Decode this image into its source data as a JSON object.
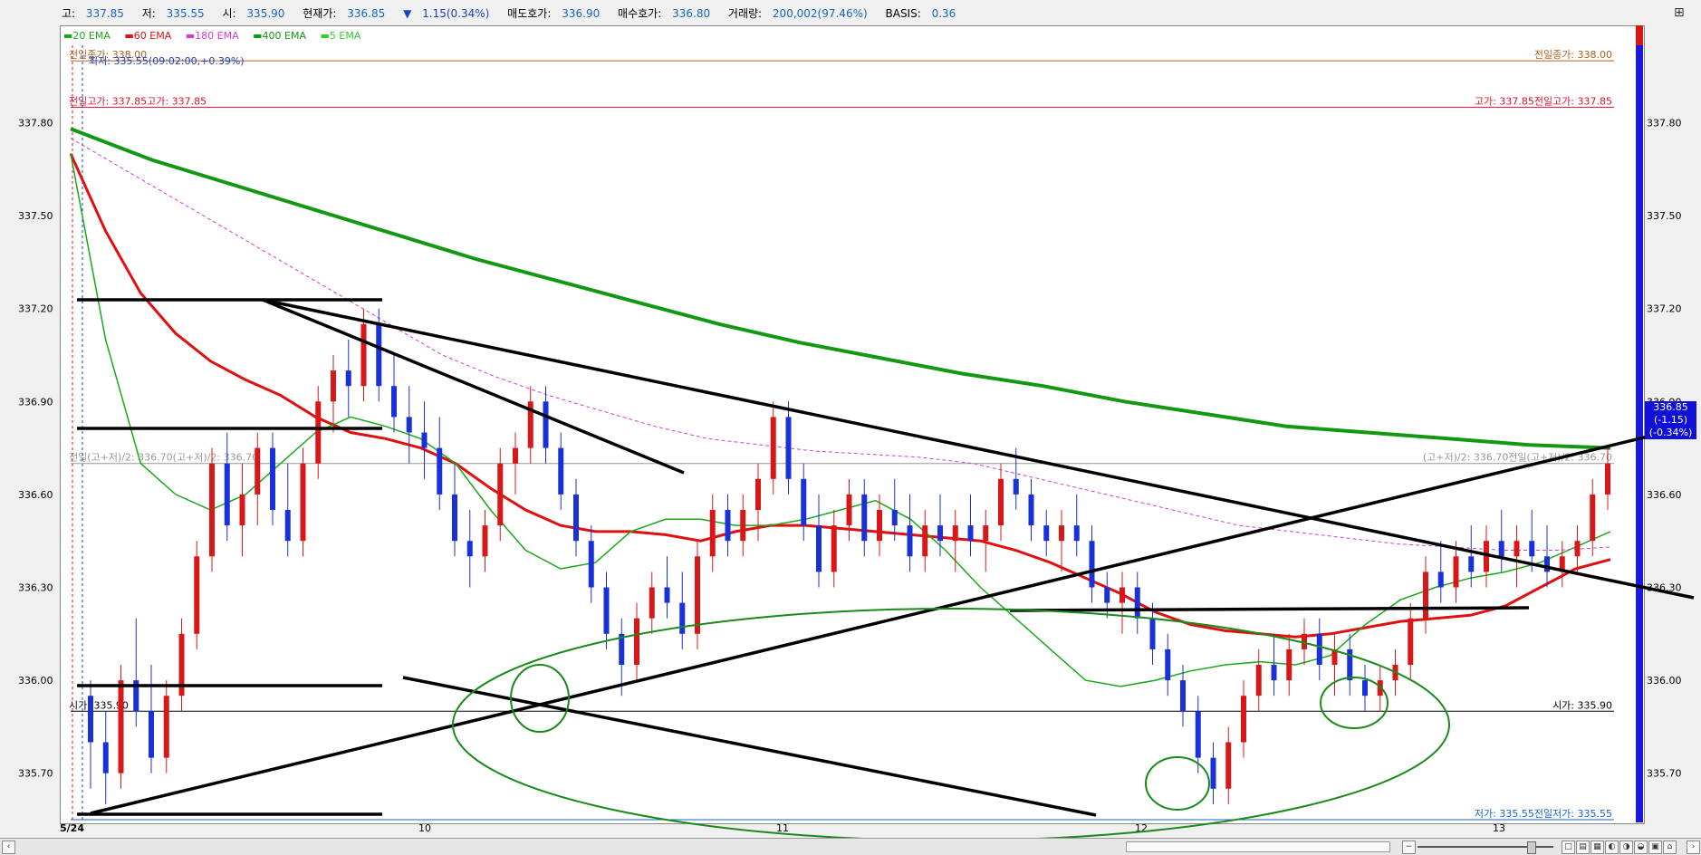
{
  "header": {
    "high_label": "고:",
    "high": "337.85",
    "low_label": "저:",
    "low": "335.55",
    "open_label": "시:",
    "open": "335.90",
    "current_label": "현재가:",
    "current": "336.85",
    "change_arrow": "▼",
    "change": "1.15(0.34%)",
    "ask_label": "매도호가:",
    "ask": "336.90",
    "bid_label": "매수호가:",
    "bid": "336.80",
    "volume_label": "거래량:",
    "volume": "200,002(97.46%)",
    "basis_label": "BASIS:",
    "basis": "0.36",
    "menu_icon": "grid-menu-icon"
  },
  "legend": [
    {
      "label": "20 EMA",
      "color": "#1aa81a"
    },
    {
      "label": "60 EMA",
      "color": "#e01010"
    },
    {
      "label": "180 EMA",
      "color": "#d040d0"
    },
    {
      "label": "400 EMA",
      "color": "#139813"
    },
    {
      "label": "5 EMA",
      "color": "#33cc33"
    }
  ],
  "price_tag": {
    "price": "336.85",
    "change": "(-1.15)",
    "pct": "(-0.34%)"
  },
  "chart_data": {
    "type": "candlestick",
    "title": "",
    "x_labels": [
      "5/24",
      "10",
      "11",
      "12",
      "13"
    ],
    "y_ticks": [
      "337.80",
      "337.50",
      "337.20",
      "336.90",
      "336.60",
      "336.30",
      "336.00",
      "335.70"
    ],
    "ylim": [
      335.55,
      338.05
    ],
    "reference_lines": [
      {
        "label_left": "전일종가: 338.00",
        "label_right": "전일종가: 338.00",
        "value": 338.0,
        "color": "#b06020"
      },
      {
        "label_left": "전일고가: 337.85",
        "label_left2": "고가: 337.85",
        "label_right": "고가: 337.85",
        "label_right2": "전일고가: 337.85",
        "value": 337.85,
        "color": "#e01030"
      },
      {
        "label_left": "전일(고+저)/2: 336.70",
        "label_left2": "(고+저)/2: 336.70",
        "label_right": "(고+저)/2: 336.70",
        "label_right2": "전일(고+저)/2: 336.70",
        "value": 336.7,
        "color": "#999999"
      },
      {
        "label_left": "시가: 335.90",
        "label_right": "시가: 335.90",
        "value": 335.9,
        "color": "#000000"
      },
      {
        "label_right": "저가: 335.55",
        "label_right2": "전일저가: 335.55",
        "value": 335.55,
        "color": "#1a66c4"
      }
    ],
    "annotation": "최저: 335.55(09:02:00,+0.39%)",
    "candles": [
      [
        335.95,
        336.0,
        335.65,
        335.8
      ],
      [
        335.8,
        335.9,
        335.6,
        335.7
      ],
      [
        335.7,
        336.05,
        335.65,
        336.0
      ],
      [
        336.0,
        336.2,
        335.85,
        335.9
      ],
      [
        335.9,
        336.05,
        335.7,
        335.75
      ],
      [
        335.75,
        336.0,
        335.7,
        335.95
      ],
      [
        335.95,
        336.2,
        335.9,
        336.15
      ],
      [
        336.15,
        336.45,
        336.1,
        336.4
      ],
      [
        336.4,
        336.75,
        336.35,
        336.7
      ],
      [
        336.7,
        336.8,
        336.45,
        336.5
      ],
      [
        336.5,
        336.7,
        336.4,
        336.6
      ],
      [
        336.6,
        336.8,
        336.5,
        336.75
      ],
      [
        336.75,
        336.8,
        336.5,
        336.55
      ],
      [
        336.55,
        336.7,
        336.4,
        336.45
      ],
      [
        336.45,
        336.75,
        336.4,
        336.7
      ],
      [
        336.7,
        336.95,
        336.65,
        336.9
      ],
      [
        336.9,
        337.05,
        336.8,
        337.0
      ],
      [
        337.0,
        337.1,
        336.85,
        336.95
      ],
      [
        336.95,
        337.2,
        336.9,
        337.15
      ],
      [
        337.15,
        337.2,
        336.9,
        336.95
      ],
      [
        336.95,
        337.05,
        336.8,
        336.85
      ],
      [
        336.85,
        336.95,
        336.7,
        336.8
      ],
      [
        336.8,
        336.9,
        336.65,
        336.75
      ],
      [
        336.75,
        336.85,
        336.55,
        336.6
      ],
      [
        336.6,
        336.7,
        336.4,
        336.45
      ],
      [
        336.45,
        336.55,
        336.3,
        336.4
      ],
      [
        336.4,
        336.55,
        336.35,
        336.5
      ],
      [
        336.5,
        336.75,
        336.45,
        336.7
      ],
      [
        336.7,
        336.8,
        336.6,
        336.75
      ],
      [
        336.75,
        336.95,
        336.7,
        336.9
      ],
      [
        336.9,
        336.95,
        336.7,
        336.75
      ],
      [
        336.75,
        336.8,
        336.55,
        336.6
      ],
      [
        336.6,
        336.65,
        336.4,
        336.45
      ],
      [
        336.45,
        336.5,
        336.25,
        336.3
      ],
      [
        336.3,
        336.35,
        336.1,
        336.15
      ],
      [
        336.15,
        336.2,
        335.95,
        336.05
      ],
      [
        336.05,
        336.25,
        336.0,
        336.2
      ],
      [
        336.2,
        336.35,
        336.15,
        336.3
      ],
      [
        336.3,
        336.4,
        336.2,
        336.25
      ],
      [
        336.25,
        336.35,
        336.1,
        336.15
      ],
      [
        336.15,
        336.45,
        336.1,
        336.4
      ],
      [
        336.4,
        336.6,
        336.35,
        336.55
      ],
      [
        336.55,
        336.6,
        336.4,
        336.45
      ],
      [
        336.45,
        336.6,
        336.4,
        336.55
      ],
      [
        336.55,
        336.7,
        336.45,
        336.65
      ],
      [
        336.65,
        336.9,
        336.6,
        336.85
      ],
      [
        336.85,
        336.9,
        336.6,
        336.65
      ],
      [
        336.65,
        336.7,
        336.45,
        336.5
      ],
      [
        336.5,
        336.6,
        336.3,
        336.35
      ],
      [
        336.35,
        336.55,
        336.3,
        336.5
      ],
      [
        336.5,
        336.65,
        336.45,
        336.6
      ],
      [
        336.6,
        336.65,
        336.4,
        336.45
      ],
      [
        336.45,
        336.6,
        336.4,
        336.55
      ],
      [
        336.55,
        336.65,
        336.45,
        336.5
      ],
      [
        336.5,
        336.6,
        336.35,
        336.4
      ],
      [
        336.4,
        336.55,
        336.35,
        336.5
      ],
      [
        336.5,
        336.6,
        336.4,
        336.45
      ],
      [
        336.45,
        336.55,
        336.35,
        336.5
      ],
      [
        336.5,
        336.6,
        336.4,
        336.45
      ],
      [
        336.45,
        336.55,
        336.35,
        336.5
      ],
      [
        336.5,
        336.7,
        336.45,
        336.65
      ],
      [
        336.65,
        336.75,
        336.55,
        336.6
      ],
      [
        336.6,
        336.65,
        336.45,
        336.5
      ],
      [
        336.5,
        336.55,
        336.4,
        336.45
      ],
      [
        336.45,
        336.55,
        336.35,
        336.5
      ],
      [
        336.5,
        336.6,
        336.4,
        336.45
      ],
      [
        336.45,
        336.5,
        336.25,
        336.3
      ],
      [
        336.3,
        336.35,
        336.2,
        336.25
      ],
      [
        336.25,
        336.35,
        336.15,
        336.3
      ],
      [
        336.3,
        336.35,
        336.15,
        336.2
      ],
      [
        336.2,
        336.25,
        336.05,
        336.1
      ],
      [
        336.1,
        336.15,
        335.95,
        336.0
      ],
      [
        336.0,
        336.05,
        335.85,
        335.9
      ],
      [
        335.9,
        335.95,
        335.7,
        335.75
      ],
      [
        335.75,
        335.8,
        335.6,
        335.65
      ],
      [
        335.65,
        335.85,
        335.6,
        335.8
      ],
      [
        335.8,
        336.0,
        335.75,
        335.95
      ],
      [
        335.95,
        336.1,
        335.9,
        336.05
      ],
      [
        336.05,
        336.15,
        335.95,
        336.0
      ],
      [
        336.0,
        336.15,
        335.95,
        336.1
      ],
      [
        336.1,
        336.2,
        336.05,
        336.15
      ],
      [
        336.15,
        336.2,
        336.0,
        336.05
      ],
      [
        336.05,
        336.15,
        335.95,
        336.1
      ],
      [
        336.1,
        336.15,
        335.95,
        336.0
      ],
      [
        336.0,
        336.05,
        335.9,
        335.95
      ],
      [
        335.95,
        336.05,
        335.9,
        336.0
      ],
      [
        336.0,
        336.1,
        335.95,
        336.05
      ],
      [
        336.05,
        336.25,
        336.0,
        336.2
      ],
      [
        336.2,
        336.4,
        336.15,
        336.35
      ],
      [
        336.35,
        336.45,
        336.25,
        336.3
      ],
      [
        336.3,
        336.45,
        336.25,
        336.4
      ],
      [
        336.4,
        336.5,
        336.3,
        336.35
      ],
      [
        336.35,
        336.5,
        336.3,
        336.45
      ],
      [
        336.45,
        336.55,
        336.35,
        336.4
      ],
      [
        336.4,
        336.5,
        336.3,
        336.45
      ],
      [
        336.45,
        336.55,
        336.35,
        336.4
      ],
      [
        336.4,
        336.5,
        336.3,
        336.35
      ],
      [
        336.35,
        336.45,
        336.3,
        336.4
      ],
      [
        336.4,
        336.5,
        336.35,
        336.45
      ],
      [
        336.45,
        336.65,
        336.4,
        336.6
      ],
      [
        336.6,
        336.75,
        336.55,
        336.7
      ]
    ],
    "series": [
      {
        "name": "60 EMA",
        "color": "#e01010",
        "values": [
          337.7,
          337.45,
          337.25,
          337.12,
          337.03,
          336.97,
          336.92,
          336.85,
          336.8,
          336.78,
          336.75,
          336.7,
          336.62,
          336.55,
          336.5,
          336.48,
          336.48,
          336.47,
          336.45,
          336.48,
          336.5,
          336.5,
          336.49,
          336.48,
          336.47,
          336.46,
          336.45,
          336.42,
          336.38,
          336.33,
          336.28,
          336.22,
          336.18,
          336.16,
          336.15,
          336.14,
          336.15,
          336.17,
          336.19,
          336.2,
          336.21,
          336.24,
          336.3,
          336.36,
          336.39
        ]
      },
      {
        "name": "20 EMA",
        "color": "#1aa81a",
        "values": [
          337.7,
          337.1,
          336.7,
          336.6,
          336.55,
          336.6,
          336.7,
          336.8,
          336.85,
          336.82,
          336.78,
          336.7,
          336.55,
          336.42,
          336.36,
          336.38,
          336.48,
          336.52,
          336.52,
          336.5,
          336.5,
          336.52,
          336.55,
          336.58,
          336.52,
          336.42,
          336.3,
          336.2,
          336.1,
          336.0,
          335.98,
          336.0,
          336.03,
          336.05,
          336.06,
          336.05,
          336.08,
          336.18,
          336.26,
          336.3,
          336.33,
          336.35,
          336.38,
          336.43,
          336.48
        ]
      },
      {
        "name": "180 EMA",
        "color": "#d040d0",
        "values": [
          337.75,
          337.65,
          337.55,
          337.45,
          337.35,
          337.25,
          337.15,
          337.05,
          336.98,
          336.92,
          336.87,
          336.82,
          336.78,
          336.76,
          336.74,
          336.73,
          336.72,
          336.7,
          336.66,
          336.62,
          336.58,
          336.54,
          336.5,
          336.48,
          336.46,
          336.44,
          336.43,
          336.42,
          336.42,
          336.43
        ]
      },
      {
        "name": "400 EMA",
        "color": "#139813",
        "values": [
          337.78,
          337.68,
          337.6,
          337.52,
          337.44,
          337.36,
          337.29,
          337.22,
          337.15,
          337.09,
          337.04,
          336.99,
          336.95,
          336.9,
          336.86,
          336.82,
          336.8,
          336.78,
          336.76,
          336.75
        ]
      }
    ],
    "grid": false
  },
  "bottom_bar": {
    "left_arrow": "‹",
    "right_arrow": "›"
  }
}
